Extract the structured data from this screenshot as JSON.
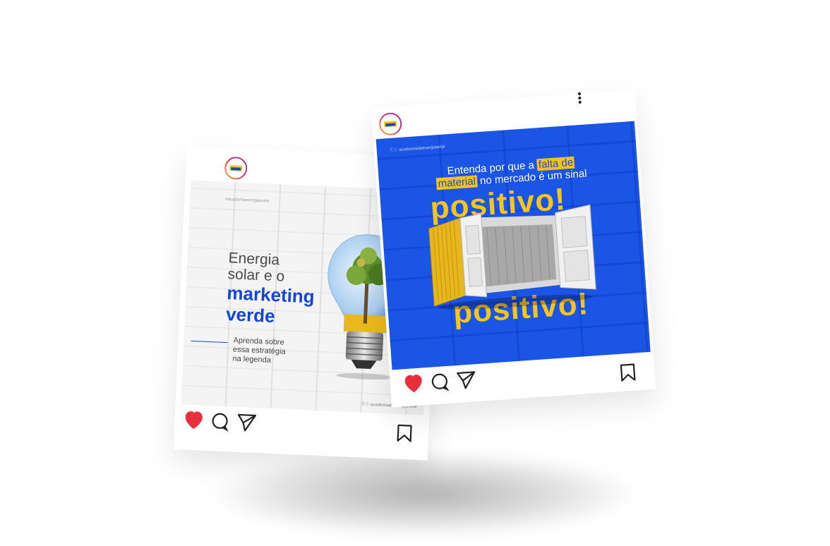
{
  "left_post": {
    "handle": "#academiaenergiasolar",
    "title_line1": "Energia",
    "title_line2": "solar e o",
    "title_line3": "marketing",
    "title_line4": "verde",
    "subtitle_line1": "Aprenda sobre",
    "subtitle_line2": "essa estratégia",
    "subtitle_line3": "na legenda",
    "footer_handle": "academiadaenergiasolar"
  },
  "right_post": {
    "handle": "academiadaenergiasolar",
    "headline_part1": "Entenda por que a",
    "headline_highlight1": "falta de",
    "headline_highlight2": "material",
    "headline_part2": "no mercado é um sinal",
    "big_word": "positivo!"
  },
  "icons": {
    "like": "heart-icon",
    "comment": "comment-icon",
    "share": "send-icon",
    "save": "bookmark-icon",
    "more": "more-vertical-icon"
  },
  "colors": {
    "brand_blue": "#1a55e6",
    "accent_yellow": "#f5c51c",
    "like_red": "#e8303a"
  }
}
